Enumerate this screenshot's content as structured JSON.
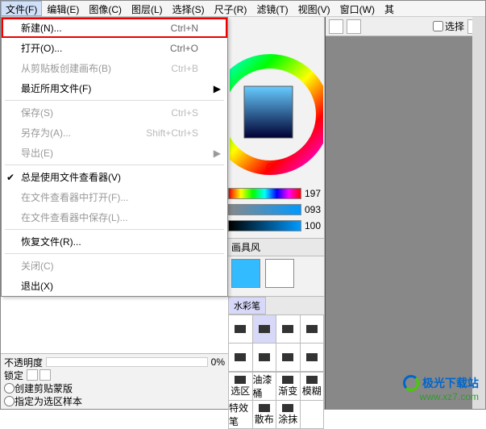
{
  "menubar": [
    {
      "label": "文件(F)",
      "active": true
    },
    {
      "label": "编辑(E)"
    },
    {
      "label": "图像(C)"
    },
    {
      "label": "图层(L)"
    },
    {
      "label": "选择(S)"
    },
    {
      "label": "尺子(R)"
    },
    {
      "label": "滤镜(T)"
    },
    {
      "label": "视图(V)"
    },
    {
      "label": "窗口(W)"
    },
    {
      "label": "其"
    }
  ],
  "file_menu": [
    {
      "label": "新建(N)...",
      "shortcut": "Ctrl+N",
      "highlight": true
    },
    {
      "label": "打开(O)...",
      "shortcut": "Ctrl+O"
    },
    {
      "label": "从剪贴板创建画布(B)",
      "shortcut": "Ctrl+B",
      "disabled": true
    },
    {
      "label": "最近所用文件(F)",
      "submenu": true
    },
    {
      "sep": true
    },
    {
      "label": "保存(S)",
      "shortcut": "Ctrl+S",
      "disabled": true
    },
    {
      "label": "另存为(A)...",
      "shortcut": "Shift+Ctrl+S",
      "disabled": true
    },
    {
      "label": "导出(E)",
      "submenu": true,
      "disabled": true
    },
    {
      "sep": true
    },
    {
      "label": "总是使用文件查看器(V)",
      "checked": true
    },
    {
      "label": "在文件查看器中打开(F)...",
      "disabled": true
    },
    {
      "label": "在文件查看器中保存(L)...",
      "disabled": true
    },
    {
      "sep": true
    },
    {
      "label": "恢复文件(R)..."
    },
    {
      "sep": true
    },
    {
      "label": "关闭(C)",
      "disabled": true
    },
    {
      "label": "退出(X)"
    }
  ],
  "toolbar": {
    "select_label": "选择"
  },
  "sliders": [
    {
      "val": "197",
      "grad": "linear-gradient(90deg,#f00,#ff0,#0f0,#0ff,#00f,#f0f,#f00)"
    },
    {
      "val": "093",
      "grad": "linear-gradient(90deg,#888,#09f)"
    },
    {
      "val": "100",
      "grad": "linear-gradient(90deg,#000,#09f)"
    }
  ],
  "brush_panel_label": "画具风",
  "brush_tabs": [
    "水彩笔"
  ],
  "brush_names": [
    "选区",
    "油漆桶",
    "渐变",
    "模糊",
    "特效笔",
    "散布",
    "涂抹"
  ],
  "swatch_colors": [
    "#33bbff",
    "#ffffff"
  ],
  "bottom": {
    "opacity_label": "不透明度",
    "opacity_val": "0%",
    "lock_label": "锁定",
    "radio1": "创建剪贴蒙版",
    "radio2": "指定为选区样本"
  },
  "watermark": {
    "text": "极光下载站",
    "url": "www.xz7.com"
  }
}
